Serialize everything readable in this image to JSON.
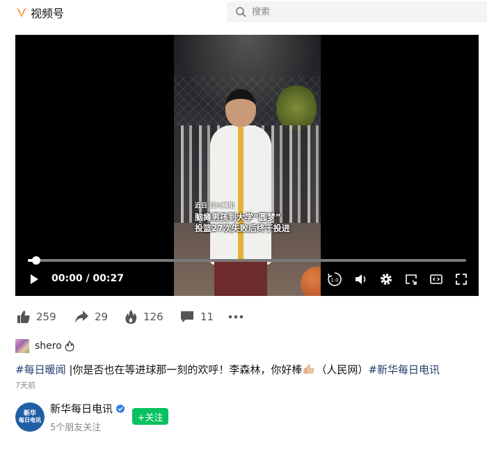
{
  "header": {
    "brand_icon": "channels-logo-icon",
    "brand_color": "#fa9d3b",
    "brand_name": "视频号",
    "search_icon": "search-icon",
    "search_placeholder": "搜索"
  },
  "player": {
    "caption_line1": "近日 四川绵阳",
    "caption_line2": "脑瘫男孩到大学“圆梦”",
    "caption_line3": "投篮27次失败后终于投进",
    "time_display": "00:00 / 00:27",
    "progress": 0.0,
    "icons": [
      "play-icon",
      "playback-speed-icon",
      "volume-icon",
      "settings-icon",
      "cast-icon",
      "picture-in-picture-icon",
      "fullscreen-icon"
    ]
  },
  "actions": {
    "like_count": "259",
    "share_count": "29",
    "fire_count": "126",
    "comment_count": "11"
  },
  "author": {
    "name": "shero"
  },
  "post": {
    "tag1": "#每日暖闻",
    "text": " |你是否也在等进球那一刻的欢呼！李森林，你好棒",
    "text2": "（人民网）",
    "tag2": "#新华每日电讯",
    "time_ago": "7天前"
  },
  "account": {
    "avatar_line1": "新华",
    "avatar_line2": "每日电讯",
    "name": "新华每日电讯",
    "followers_note": "5个朋友关注",
    "follow_label": "+关注",
    "follow_color": "#08c160",
    "verified_color": "#2d7fe0"
  }
}
